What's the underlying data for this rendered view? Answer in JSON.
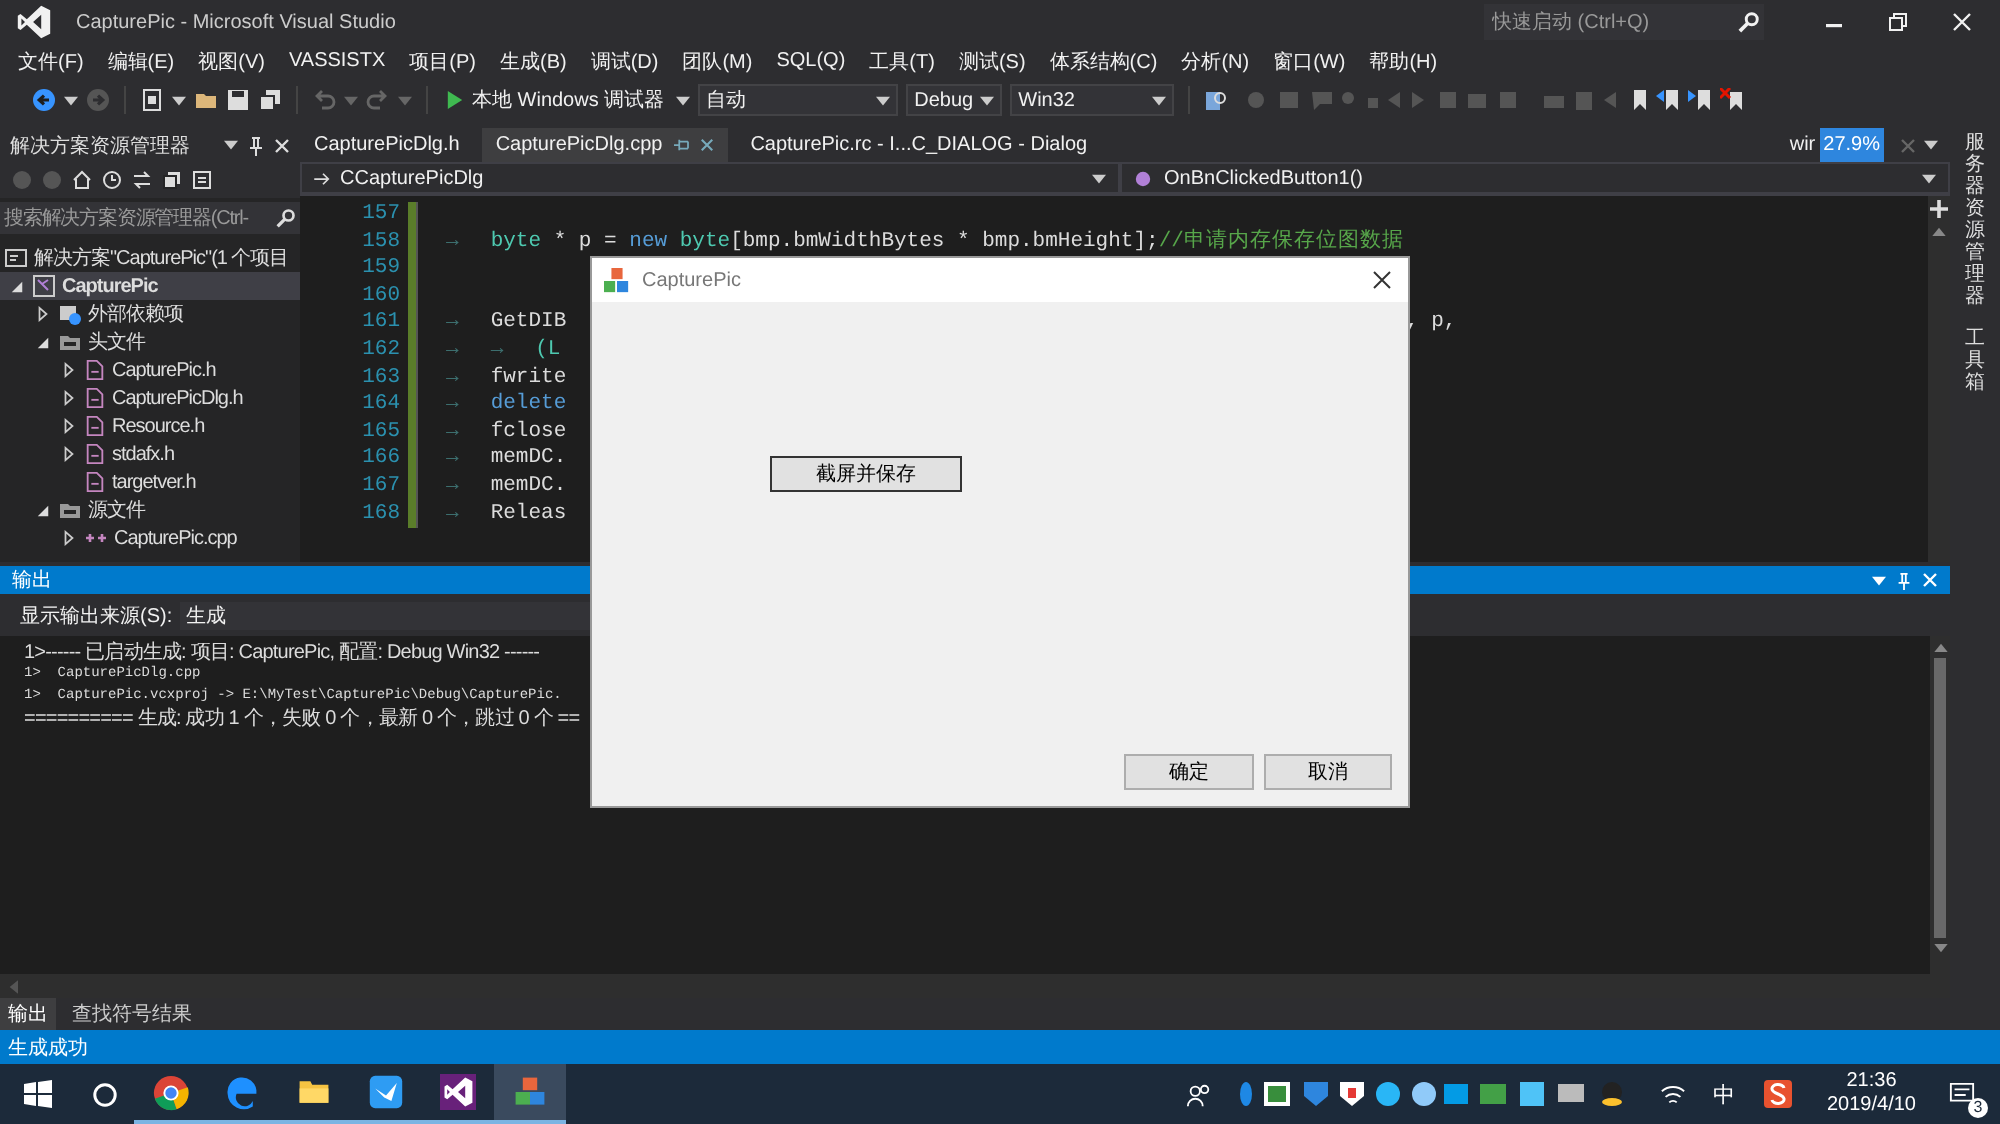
{
  "window": {
    "title": "CapturePic - Microsoft Visual Studio",
    "quick_launch": {
      "placeholder": "快速启动 (Ctrl+Q)"
    }
  },
  "menu": [
    "文件(F)",
    "编辑(E)",
    "视图(V)",
    "VASSISTX",
    "项目(P)",
    "生成(B)",
    "调试(D)",
    "团队(M)",
    "SQL(Q)",
    "工具(T)",
    "测试(S)",
    "体系结构(C)",
    "分析(N)",
    "窗口(W)",
    "帮助(H)"
  ],
  "toolbar": {
    "debugger": "本地 Windows 调试器",
    "combos": [
      "自动",
      "Debug",
      "Win32"
    ]
  },
  "solution_explorer": {
    "title": "解决方案资源管理器",
    "search": {
      "placeholder": "搜索解决方案资源管理器(Ctrl-"
    },
    "tree": [
      {
        "label": "解决方案\"CapturePic\"(1 个项目",
        "kind": "solution",
        "children": [
          {
            "label": "CapturePic",
            "kind": "project",
            "expanded": true,
            "children": [
              {
                "label": "外部依赖项",
                "kind": "references",
                "expanded": false
              },
              {
                "label": "头文件",
                "kind": "folder",
                "expanded": true,
                "children": [
                  {
                    "label": "CapturePic.h",
                    "kind": "file",
                    "expanded": false
                  },
                  {
                    "label": "CapturePicDlg.h",
                    "kind": "file",
                    "expanded": false
                  },
                  {
                    "label": "Resource.h",
                    "kind": "file",
                    "expanded": false
                  },
                  {
                    "label": "stdafx.h",
                    "kind": "file",
                    "expanded": false
                  },
                  {
                    "label": "targetver.h",
                    "kind": "file"
                  }
                ]
              },
              {
                "label": "源文件",
                "kind": "folder",
                "expanded": true,
                "children": [
                  {
                    "label": "CapturePic.cpp",
                    "kind": "source",
                    "expanded": false
                  }
                ]
              }
            ]
          }
        ]
      }
    ]
  },
  "document_tabs": [
    {
      "label": "CapturePicDlg.h",
      "selected": false
    },
    {
      "label": "CapturePicDlg.cpp",
      "selected": true
    },
    {
      "label": "CapturePic.rc - I...C_DIALOG - Dialog",
      "selected": false
    }
  ],
  "overflow_tab": "wir",
  "recorder_badge": "27.9%",
  "navigation": {
    "class": "CCapturePicDlg",
    "member": "OnBnClickedButton1()"
  },
  "code_lines": [
    {
      "number": "157"
    },
    {
      "number": "158",
      "tokens": [
        {
          "text": "→",
          "kind": "whitespace"
        },
        {
          "text": "byte",
          "kind": "type"
        },
        {
          "text": " * p = ",
          "kind": "plain"
        },
        {
          "text": "new ",
          "kind": "keyword"
        },
        {
          "text": "byte",
          "kind": "type"
        },
        {
          "text": "[bmp.bmWidthBytes * bmp.bmHeight];",
          "kind": "plain"
        },
        {
          "text": "//申请内存保存位图数据",
          "kind": "comment"
        }
      ]
    },
    {
      "number": "159"
    },
    {
      "number": "160"
    },
    {
      "number": "161",
      "tokens": [
        {
          "text": "→",
          "kind": "whitespace"
        },
        {
          "text": "GetDIB",
          "kind": "plain"
        }
      ],
      "tail": ", p,"
    },
    {
      "number": "162",
      "tokens": [
        {
          "text": "→",
          "kind": "whitespace"
        },
        {
          "text": "→",
          "kind": "whitespace"
        },
        {
          "text": "(L",
          "kind": "type"
        }
      ]
    },
    {
      "number": "163",
      "tokens": [
        {
          "text": "→",
          "kind": "whitespace"
        },
        {
          "text": "fwrite",
          "kind": "plain"
        }
      ]
    },
    {
      "number": "164",
      "tokens": [
        {
          "text": "→",
          "kind": "whitespace"
        },
        {
          "text": "delete",
          "kind": "keyword"
        }
      ]
    },
    {
      "number": "165",
      "tokens": [
        {
          "text": "→",
          "kind": "whitespace"
        },
        {
          "text": "fclose",
          "kind": "plain"
        }
      ]
    },
    {
      "number": "166",
      "tokens": [
        {
          "text": "→",
          "kind": "whitespace"
        },
        {
          "text": "memDC.",
          "kind": "plain"
        }
      ]
    },
    {
      "number": "167",
      "tokens": [
        {
          "text": "→",
          "kind": "whitespace"
        },
        {
          "text": "memDC.",
          "kind": "plain"
        }
      ]
    },
    {
      "number": "168",
      "tokens": [
        {
          "text": "→",
          "kind": "whitespace"
        },
        {
          "text": "Releas",
          "kind": "plain"
        }
      ]
    }
  ],
  "side_tabs": [
    "服务器资源管理器",
    "工具箱"
  ],
  "output": {
    "title": "输出",
    "source_label": "显示输出来源(S):",
    "source": "生成",
    "lines": [
      "1>------ 已启动生成: 项目: CapturePic, 配置: Debug Win32 ------",
      "1>  CapturePicDlg.cpp",
      "1>  CapturePic.vcxproj -> E:\\MyTest\\CapturePic\\Debug\\CapturePic.",
      "========== 生成: 成功 1 个，失败 0 个，最新 0 个，跳过 0 个 =="
    ],
    "tabs": [
      {
        "label": "输出",
        "selected": true
      },
      {
        "label": "查找符号结果",
        "selected": false
      }
    ]
  },
  "status": "生成成功",
  "dialog": {
    "title": "CapturePic",
    "buttons": [
      {
        "label": "截屏并保存",
        "kind": "action"
      },
      {
        "label": "确定",
        "kind": "ok"
      },
      {
        "label": "取消",
        "kind": "cancel"
      }
    ]
  },
  "taskbar": {
    "apps": [
      {
        "kind": "chrome",
        "selected": false
      },
      {
        "kind": "edge",
        "selected": false
      },
      {
        "kind": "explorer",
        "selected": false
      },
      {
        "kind": "bird",
        "selected": false
      },
      {
        "kind": "vs",
        "selected": false
      },
      {
        "kind": "cubes",
        "selected": true
      }
    ],
    "ime": "中",
    "time": "21:36",
    "date": "2019/4/10",
    "notifications": "3"
  }
}
